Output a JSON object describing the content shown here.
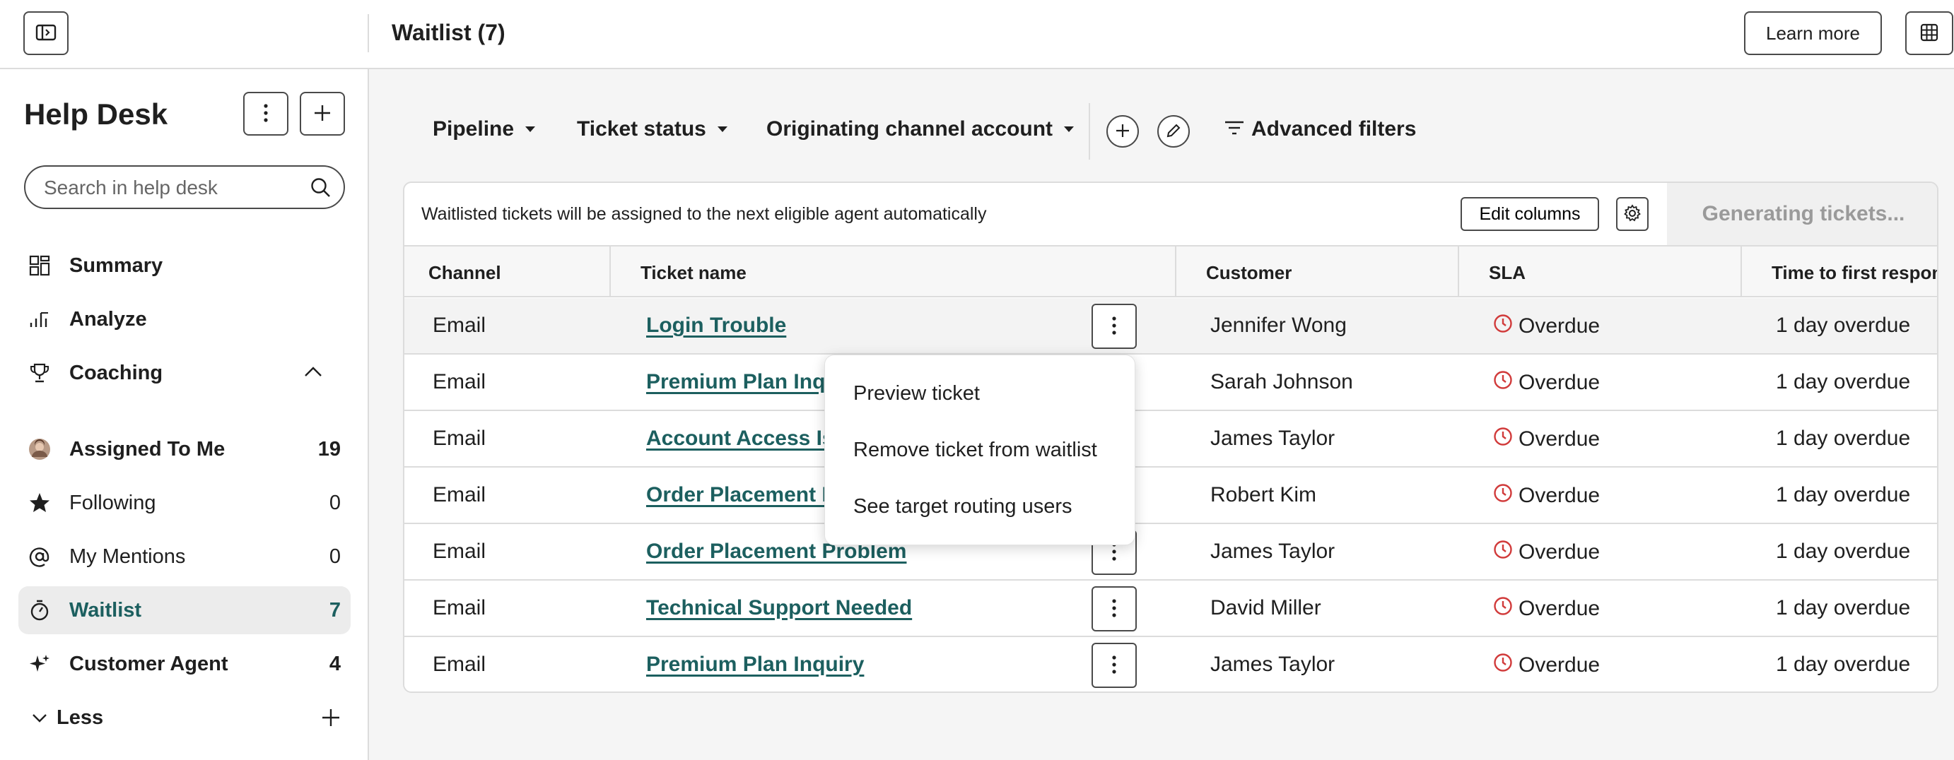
{
  "header": {
    "title": "Waitlist (7)",
    "learn_more": "Learn more"
  },
  "sidebar": {
    "title": "Help Desk",
    "search_placeholder": "Search in help desk",
    "items": [
      {
        "label": "Summary",
        "count": ""
      },
      {
        "label": "Analyze",
        "count": ""
      },
      {
        "label": "Coaching",
        "count": ""
      },
      {
        "label": "Assigned To Me",
        "count": "19"
      },
      {
        "label": "Following",
        "count": "0"
      },
      {
        "label": "My Mentions",
        "count": "0"
      },
      {
        "label": "Waitlist",
        "count": "7"
      },
      {
        "label": "Customer Agent",
        "count": "4"
      },
      {
        "label": "Less",
        "count": ""
      }
    ]
  },
  "filters": {
    "pipeline": "Pipeline",
    "ticket_status": "Ticket status",
    "originating": "Originating channel account",
    "advanced": "Advanced filters"
  },
  "panel": {
    "info": "Waitlisted tickets will be assigned to the next eligible agent automatically",
    "edit_columns": "Edit columns",
    "generating": "Generating tickets..."
  },
  "table": {
    "columns": [
      "Channel",
      "Ticket name",
      "Customer",
      "SLA",
      "Time to first respons"
    ],
    "rows": [
      {
        "channel": "Email",
        "name": "Login Trouble",
        "customer": "Jennifer Wong",
        "sla": "Overdue",
        "ttfr": "1 day overdue"
      },
      {
        "channel": "Email",
        "name": "Premium Plan Inqu",
        "customer": "Sarah Johnson",
        "sla": "Overdue",
        "ttfr": "1 day overdue"
      },
      {
        "channel": "Email",
        "name": "Account Access Iss",
        "customer": "James Taylor",
        "sla": "Overdue",
        "ttfr": "1 day overdue"
      },
      {
        "channel": "Email",
        "name": "Order Placement P",
        "customer": "Robert Kim",
        "sla": "Overdue",
        "ttfr": "1 day overdue"
      },
      {
        "channel": "Email",
        "name": "Order Placement Problem",
        "customer": "James Taylor",
        "sla": "Overdue",
        "ttfr": "1 day overdue"
      },
      {
        "channel": "Email",
        "name": "Technical Support Needed",
        "customer": "David Miller",
        "sla": "Overdue",
        "ttfr": "1 day overdue"
      },
      {
        "channel": "Email",
        "name": "Premium Plan Inquiry",
        "customer": "James Taylor",
        "sla": "Overdue",
        "ttfr": "1 day overdue"
      }
    ]
  },
  "context_menu": {
    "items": [
      "Preview ticket",
      "Remove ticket from waitlist",
      "See target routing users"
    ]
  },
  "colors": {
    "accent": "#1c5f5f",
    "overdue": "#d13b3b"
  }
}
